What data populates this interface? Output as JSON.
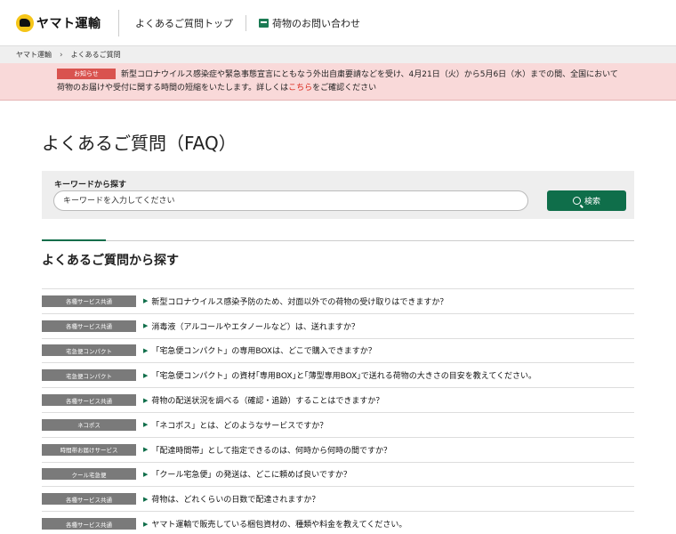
{
  "header": {
    "logo_text": "ヤマト運輸",
    "nav": [
      "よくあるご質問トップ",
      "荷物のお問い合わせ"
    ]
  },
  "breadcrumb": [
    "ヤマト運輸",
    "よくあるご質問"
  ],
  "notice": {
    "badge": "お知らせ",
    "text": "新型コロナウイルス感染症や緊急事態宣言にともなう外出自粛要請などを受け、4月21日（火）から5月6日（水）までの間、全国において荷物のお届けや受付に関する時間の短縮をいたします。詳しくは",
    "link": "こちら",
    "suffix": "をご確認ください"
  },
  "page_title": "よくあるご質問（FAQ）",
  "search": {
    "label": "キーワードから探す",
    "placeholder": "キーワードを入力してください",
    "button": "検索"
  },
  "section_title": "よくあるご質問から探す",
  "faqs": [
    {
      "category": "各種サービス共通",
      "question": "新型コロナウイルス感染予防のため、対面以外での荷物の受け取りはできますか？"
    },
    {
      "category": "各種サービス共通",
      "question": "消毒液（アルコールやエタノールなど）は、送れますか？"
    },
    {
      "category": "宅急便コンパクト",
      "question": "「宅急便コンパクト」の専用BOXは、どこで購入できますか？"
    },
    {
      "category": "宅急便コンパクト",
      "question": "「宅急便コンパクト」の資材｢専用BOX｣と｢薄型専用BOX｣で送れる荷物の大きさの目安を教えてください。"
    },
    {
      "category": "各種サービス共通",
      "question": "荷物の配送状況を調べる（確認・追跡）することはできますか？"
    },
    {
      "category": "ネコポス",
      "question": "「ネコポス」とは、どのようなサービスですか？"
    },
    {
      "category": "時間帯お届けサービス",
      "question": "「配達時間帯」として指定できるのは、何時から何時の間ですか？"
    },
    {
      "category": "クール宅急便",
      "question": "「クール宅急便」の発送は、どこに頼めば良いですか？"
    },
    {
      "category": "各種サービス共通",
      "question": "荷物は、どれくらいの日数で配達されますか？"
    },
    {
      "category": "各種サービス共通",
      "question": "ヤマト運輸で販売している梱包資材の、種類や料金を教えてください。"
    }
  ]
}
